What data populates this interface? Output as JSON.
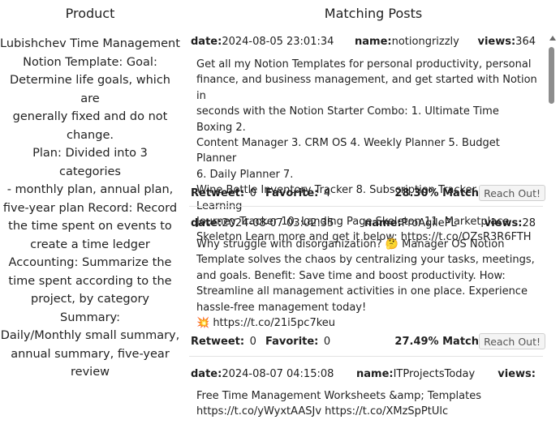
{
  "headers": {
    "product": "Product",
    "posts": "Matching Posts"
  },
  "product": {
    "description": "Lubishchev Time Management\nNotion Template: Goal:\nDetermine life goals, which are\ngenerally fixed and do not\nchange.\nPlan: Divided into 3 categories\n- monthly plan, annual plan,\nfive-year plan Record: Record\nthe time spent on events to\ncreate a time ledger\nAccounting: Summarize the\ntime spent according to the\nproject, by category Summary:\nDaily/Monthly small summary,\nannual summary, five-year\nreview"
  },
  "labels": {
    "date": "date:",
    "name": "name:",
    "views": "views:",
    "retweet": "Retweet:",
    "favorite": "Favorite:",
    "match_suffix": " Match",
    "reach_out": "Reach Out!"
  },
  "posts": [
    {
      "date": "2024-08-05 23:01:34",
      "name": "notiongrizzly",
      "views": "364",
      "text": "Get all my Notion Templates for personal productivity, personal\nfinance, and business management, and get started with Notion in\nseconds with the Notion Starter Combo: 1. Ultimate Time Boxing 2.\nContent Manager 3. CRM OS 4. Weekly Planner 5. Budget Planner\n6. Daily Planner 7.\nWine Bottle Inventory Tracker 8. Subscription Tracker 9. Learning\nJourney Tracker 10. Landing Page Skeleton 11. Marketplace\nSkeleton Learn more and get it below: https://t.co/OZsR3R6FTH",
      "retweet": "0",
      "favorite": "4",
      "match": "28.30%"
    },
    {
      "date": "2024-08-07 03:02:35",
      "name": "ProAgilePL",
      "views": "28",
      "text": "Why struggle with disorganization? 🤔 Manager OS Notion\nTemplate solves the chaos by centralizing your tasks, meetings,\nand goals. Benefit: Save time and boost productivity. How:\nStreamline all management activities in one place. Experience\nhassle-free management today!\n💥 https://t.co/21i5pc7keu",
      "retweet": "0",
      "favorite": "0",
      "match": "27.49%"
    },
    {
      "date": "2024-08-07 04:15:08",
      "name": "ITProjectsToday",
      "views": "",
      "text": "Free Time Management Worksheets &amp; Templates\nhttps://t.co/yWyxtAASJv https://t.co/XMzSpPtUlc",
      "retweet": "",
      "favorite": "",
      "match": ""
    }
  ]
}
